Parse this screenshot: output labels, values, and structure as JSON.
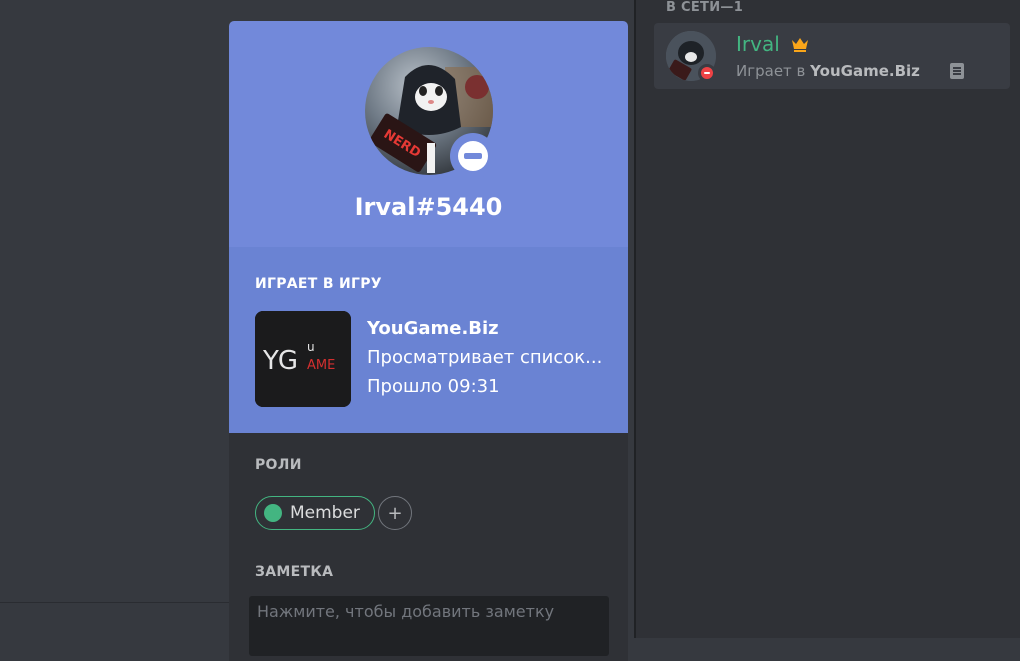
{
  "member_list": {
    "section_header": "В СЕТИ—1",
    "member": {
      "name": "Irval",
      "activity_prefix": "Играет в ",
      "activity_game": "YouGame.Biz",
      "name_color": "#43b581",
      "status": "dnd",
      "crown_icon": "crown-icon",
      "rich_presence_icon": "document-icon"
    }
  },
  "profile": {
    "username": "Irval#5440",
    "status": "dnd",
    "header_color": "#7289da",
    "activity": {
      "header": "ИГРАЕТ В ИГРУ",
      "game_name": "YouGame.Biz",
      "details": "Просматривает список...",
      "elapsed": "Прошло 09:31",
      "game_logo": {
        "y_g": "YG",
        "u": "u",
        "ame": "AME"
      }
    },
    "roles": {
      "title": "РОЛИ",
      "items": [
        {
          "name": "Member",
          "color": "#43b581"
        }
      ],
      "add_icon": "+"
    },
    "note": {
      "title": "ЗАМЕТКА",
      "placeholder": "Нажмите, чтобы добавить заметку",
      "value": ""
    },
    "avatar_text": "NERD"
  }
}
